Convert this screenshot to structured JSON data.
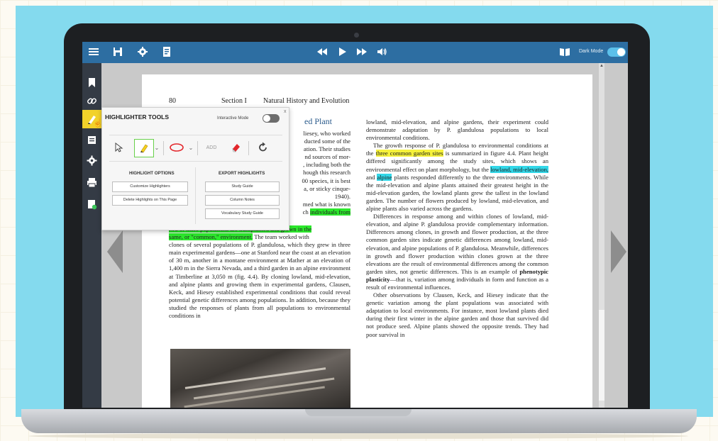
{
  "topbar": {
    "dark_mode_label": "Dark Mode",
    "icons": [
      "menu-icon",
      "save-icon",
      "settings-icon",
      "document-icon",
      "rewind-icon",
      "play-icon",
      "fast-forward-icon",
      "volume-icon",
      "book-icon"
    ]
  },
  "sidebar": {
    "icons": [
      "bookmark-icon",
      "link-icon",
      "highlighter-icon",
      "notes-icon",
      "gear-icon",
      "print-icon",
      "checklist-icon"
    ]
  },
  "page": {
    "page_number": "80",
    "section": "Section I",
    "section_title": "Natural History and Evolution",
    "chapter_title_fragment": "ed Plant",
    "left_frag": [
      "liesey, who worked",
      "ducted some of the",
      "ation. Their studies",
      "nd sources of mor-",
      ", including both the",
      "hough this research",
      "00 species, it is best",
      "a, or sticky cinque-",
      "1940).",
      "med what is known",
      "ch"
    ],
    "left_frag_hl": "individuals from",
    "left_hl_line2": "two or more populations are transplanted and grown in the",
    "left_hl_line3a": "same, or \"common,\" environment.",
    "left_hl_line3b": " The team worked with",
    "left_body": "clones of several populations of P. glandulosa, which they grew in three main experimental gardens—one at Stanford near the coast at an elevation of 30 m, another in a montane environment at Mather at an elevation of 1,400 m in the Sierra Nevada, and a third garden in an alpine environment at Timberline at 3,050 m (fig. 4.4). By cloning lowland, mid-elevation, and alpine plants and growing them in experimental gardens, Clausen, Keck, and Hiesey established experimental conditions that could reveal potential genetic differences among populations. In addition, because they studied the responses of plants from all populations to environmental conditions in",
    "right_p1": "lowland, mid-elevation, and alpine gardens, their experiment could demonstrate adaptation by P. glandulosa populations to local environmental conditions.",
    "right_p2a": "The growth response of P. glandulosa to environmental conditions at the ",
    "right_p2_hl": "three common garden sites",
    "right_p2b": " is summarized in figure 4.4. Plant height differed significantly among the study sites, which shows an environmental effect on plant morphology, but the ",
    "right_p2_hl2": "lowland, mid-elevation,",
    "right_p2c": " and ",
    "right_p2_hl3": "alpine",
    "right_p2d": " plants responded differently to the three environments. While the mid-elevation and alpine plants attained their greatest height in the mid-elevation garden, the lowland plants grew the tallest in the lowland garden. The number of flowers produced by lowland, mid-elevation, and alpine plants also varied across the gardens.",
    "right_p3a": "Differences in response among and within clones of lowland, mid-elevation, and alpine P. glandulosa provide complementary information. Differences among clones, in growth and flower production, at the three common garden sites indicate genetic differences among lowland, mid-elevation, and alpine populations of P. glandulosa. Meanwhile, differences in growth and flower production within clones grown at the three elevations are the result of environmental differences among the common garden sites, not genetic differences. This is an example of ",
    "right_p3_bold": "phenotypic plasticity",
    "right_p3b": "—that is, variation among individuals in form and function as a result of environmental influences.",
    "right_p4": "Other observations by Clausen, Keck, and Hiesey indicate that the genetic variation among the plant populations was associated with adaptation to local environments. For instance, most lowland plants died during their first winter in the alpine garden and those that survived did not produce seed. Alpine plants showed the opposite trends. They had poor survival in"
  },
  "popup": {
    "title": "HIGHLIGHTER TOOLS",
    "interactive_mode": "Interactive Mode",
    "add_label": "ADD",
    "highlight_options_title": "HIGHLIGHT OPTIONS",
    "export_title": "EXPORT HIGHLIGHTS",
    "customize": "Customize Highlighters",
    "delete": "Delete Highlights on This Page",
    "study_guide": "Study Guide",
    "column_notes": "Column Notes",
    "vocab_guide": "Vocabulary Study Guide",
    "close": "x"
  },
  "colors": {
    "topbar": "#2d6ea2",
    "sidebar": "#343b45",
    "highlight_yellow": "#f6f23a",
    "highlight_cyan": "#32d7e8",
    "highlight_green": "#2ce82c",
    "active_tool": "#f2d22a"
  }
}
